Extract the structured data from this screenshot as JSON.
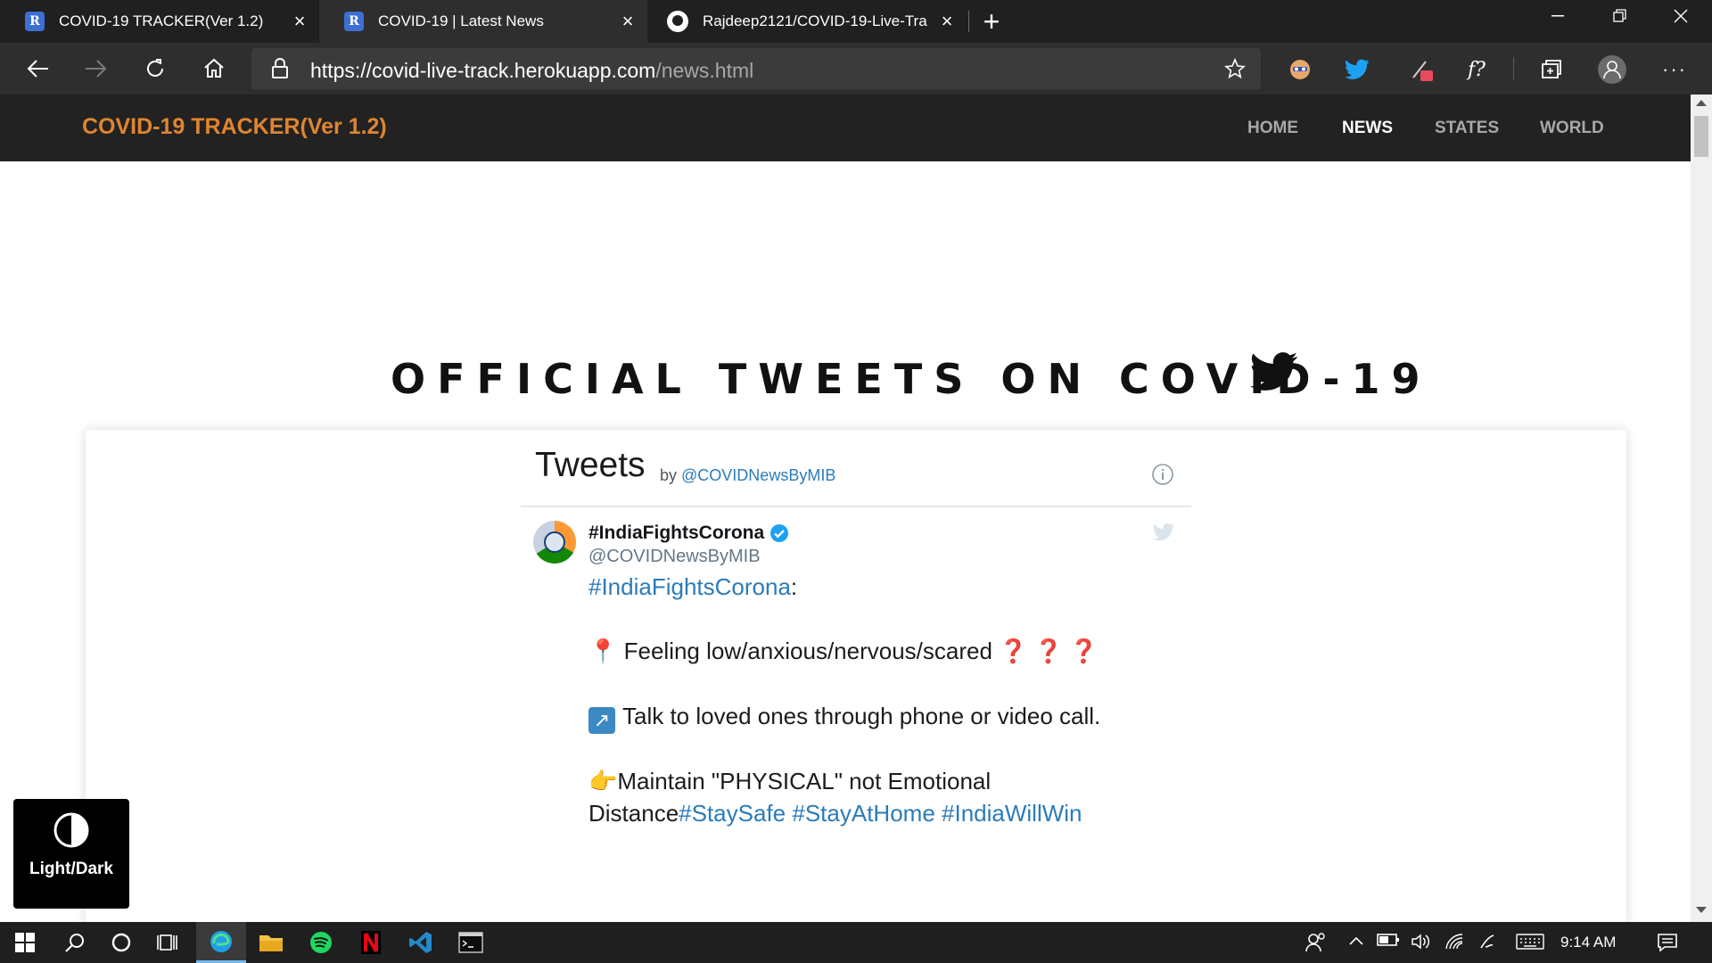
{
  "browser": {
    "tabs": [
      {
        "title": "COVID-19 TRACKER(Ver 1.2)",
        "favicon": "R",
        "active": false
      },
      {
        "title": "COVID-19 | Latest News",
        "favicon": "R",
        "active": true
      },
      {
        "title": "Rajdeep2121/COVID-19-Live-Tra",
        "favicon": "github",
        "active": false
      }
    ],
    "url_host": "https://covid-live-track.herokuapp.com",
    "url_path": "/news.html"
  },
  "site": {
    "brand": "COVID-19 TRACKER(Ver 1.2)",
    "brand_color": "#e0852f",
    "nav": [
      {
        "label": "HOME",
        "active": false
      },
      {
        "label": "NEWS",
        "active": true
      },
      {
        "label": "STATES",
        "active": false
      },
      {
        "label": "WORLD",
        "active": false
      }
    ]
  },
  "main": {
    "heading": "OFFICIAL TWEETS ON COVID-19",
    "heading_icon": "twitter-bird-icon"
  },
  "timeline": {
    "title": "Tweets",
    "by_prefix": "by",
    "by_handle": "@COVIDNewsByMIB",
    "tweet": {
      "author": "#IndiaFightsCorona",
      "handle": "@COVIDNewsByMIB",
      "verified": true,
      "hashtag_intro": "#IndiaFightsCorona",
      "colon": ":",
      "pin_emoji": "📍",
      "line1": "Feeling low/anxious/nervous/scared",
      "question_marks": "❓ ❓ ❓",
      "arrow_emoji": "↗",
      "line2": "Talk to loved ones through phone or video call.",
      "point_emoji": "👉",
      "line3": "Maintain \"PHYSICAL\" not Emotional",
      "line4_text": "Distance",
      "tags": [
        "#StaySafe",
        "#StayAtHome",
        "#IndiaWillWin"
      ]
    }
  },
  "theme_toggle": {
    "label": "Light/Dark"
  },
  "taskbar": {
    "time": "9:14 AM",
    "apps": [
      "windows-start",
      "search",
      "cortana",
      "task-view",
      "edge",
      "file-explorer",
      "spotify",
      "netflix",
      "vscode",
      "terminal"
    ]
  }
}
